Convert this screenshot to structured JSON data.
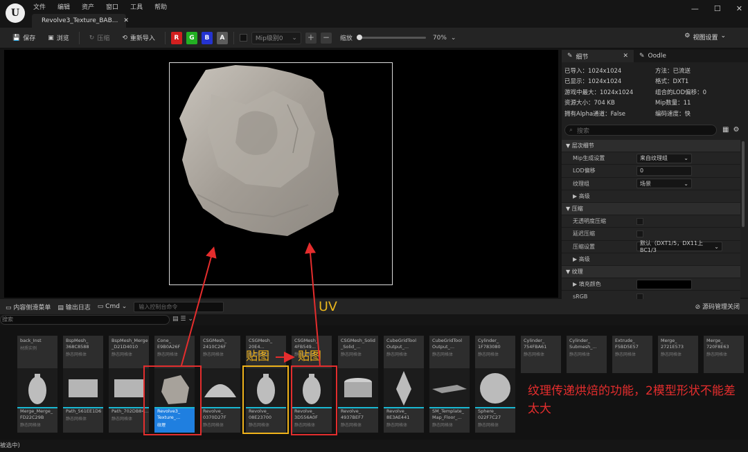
{
  "menu": [
    "文件",
    "编辑",
    "资产",
    "窗口",
    "工具",
    "帮助"
  ],
  "tab_title": "Revolve3_Texture_BAB...",
  "window_controls": [
    "—",
    "☐",
    "✕"
  ],
  "toolbar": {
    "save": "保存",
    "browse": "浏览",
    "compress": "压缩",
    "reimport": "重新导入",
    "channels": [
      "R",
      "G",
      "B",
      "A"
    ],
    "channel_colors": [
      "#d21f1f",
      "#23b023",
      "#2433d0",
      "#5c5c5c"
    ],
    "mip_level": "Mip级别0",
    "zoom_label": "缩放",
    "zoom_value": "70%",
    "zoom_fraction": 0,
    "view_settings": "视图设置"
  },
  "details": {
    "tab_details": "细节",
    "tab_oodle": "Oodle",
    "info": [
      [
        "已导入：1024x1024",
        "方法：已流送"
      ],
      [
        "已显示：1024x1024",
        "格式：DXT1"
      ],
      [
        "游戏中最大：1024x1024",
        "组合的LOD偏移：0"
      ],
      [
        "资源大小：704 KB",
        "Mip数量：11"
      ],
      [
        "拥有Alpha通道：False",
        "编码速度：快"
      ]
    ],
    "search_placeholder": "搜索",
    "props": [
      {
        "type": "cat",
        "label": "层次细节",
        "arrow": "▼"
      },
      {
        "type": "dd",
        "label": "Mip生成设置",
        "value": "来自纹理组"
      },
      {
        "type": "text",
        "label": "LOD偏移",
        "value": "0"
      },
      {
        "type": "dd",
        "label": "纹理组",
        "value": "场景"
      },
      {
        "type": "sub",
        "label": "高级",
        "arrow": "▶"
      },
      {
        "type": "cat",
        "label": "压缩",
        "arrow": "▼"
      },
      {
        "type": "chk",
        "label": "无透明度压缩"
      },
      {
        "type": "chk",
        "label": "延迟压缩"
      },
      {
        "type": "dd",
        "label": "压缩设置",
        "value": "默认（DXT1/5，DX11上BC1/3"
      },
      {
        "type": "sub",
        "label": "高级",
        "arrow": "▶"
      },
      {
        "type": "cat",
        "label": "纹理",
        "arrow": "▼"
      },
      {
        "type": "color",
        "label": "填充颜色",
        "arrow": "▶"
      },
      {
        "type": "chk",
        "label": "sRGB"
      }
    ]
  },
  "bottombar": {
    "drawer": "内容侧滑菜单",
    "output_log": "输出日志",
    "cmd": "Cmd",
    "cmd_placeholder": "输入控制台命令",
    "source_control": "源码管理关闭"
  },
  "content_browser": {
    "search_placeholder": "搜索",
    "row1": [
      {
        "name": "back_Inst",
        "type": "材质实例"
      },
      {
        "name": "BspMesh_ 368C8588",
        "type": "静态网格体"
      },
      {
        "name": "BspMesh_Merge _D21D4010",
        "type": "静态网格体"
      },
      {
        "name": "Cone_ E9B0A26F",
        "type": "静态网格体"
      },
      {
        "name": "CSGMesh_ 2410C26F",
        "type": "静态网格体"
      },
      {
        "name": "CSGMesh_ 20E4...",
        "type": "静态网格体"
      },
      {
        "name": "CSGMesh_ 4FB549...",
        "type": "静态网格体"
      },
      {
        "name": "CSGMesh_Solid _Solid_...",
        "type": "静态网格体"
      },
      {
        "name": "CubeGridTool Output_...",
        "type": "静态网格体"
      },
      {
        "name": "CubeGridTool Output_...",
        "type": "静态网格体"
      },
      {
        "name": "Cylinder_ 1F783080",
        "type": "静态网格体"
      },
      {
        "name": "Cylinder_ 754FBA61",
        "type": "静态网格体"
      },
      {
        "name": "Cylinder_ Submesh_...",
        "type": "静态网格体"
      },
      {
        "name": "Extrude_ F5BD5E57",
        "type": "静态网格体"
      },
      {
        "name": "Merge_ 2721E573",
        "type": "静态网格体"
      },
      {
        "name": "Merge_ 720F8E63",
        "type": "静态网格体"
      }
    ],
    "row2": [
      {
        "name": "Merge_Merge_ FD22C29B",
        "type": "静态网格体"
      },
      {
        "name": "Path_561EE1D6",
        "type": "静态网格体"
      },
      {
        "name": "Path_702DB84...",
        "type": "静态网格体"
      },
      {
        "name": "Revolve3_ Texture_...",
        "type": "纹理"
      },
      {
        "name": "Revolve_ 0370D27F",
        "type": "静态网格体"
      },
      {
        "name": "Revolve_ 08E23700",
        "type": "静态网格体"
      },
      {
        "name": "Revolve_ 3D556A0F",
        "type": "静态网格体"
      },
      {
        "name": "Revolve_ 4937BEF7",
        "type": "静态网格体"
      },
      {
        "name": "Revolve_ 8E3AE441",
        "type": "静态网格体"
      },
      {
        "name": "SM_Template_ Map_Floor_...",
        "type": "静态网格体"
      },
      {
        "name": "Sphere_ 022F7C27",
        "type": "静态网格体"
      }
    ],
    "status": "被选中)"
  },
  "annotations": {
    "uv": "UV",
    "tietu": "贴图",
    "tietu2": "贴图",
    "note": "纹理传递烘焙的功能，2模型形状不能差太大"
  }
}
